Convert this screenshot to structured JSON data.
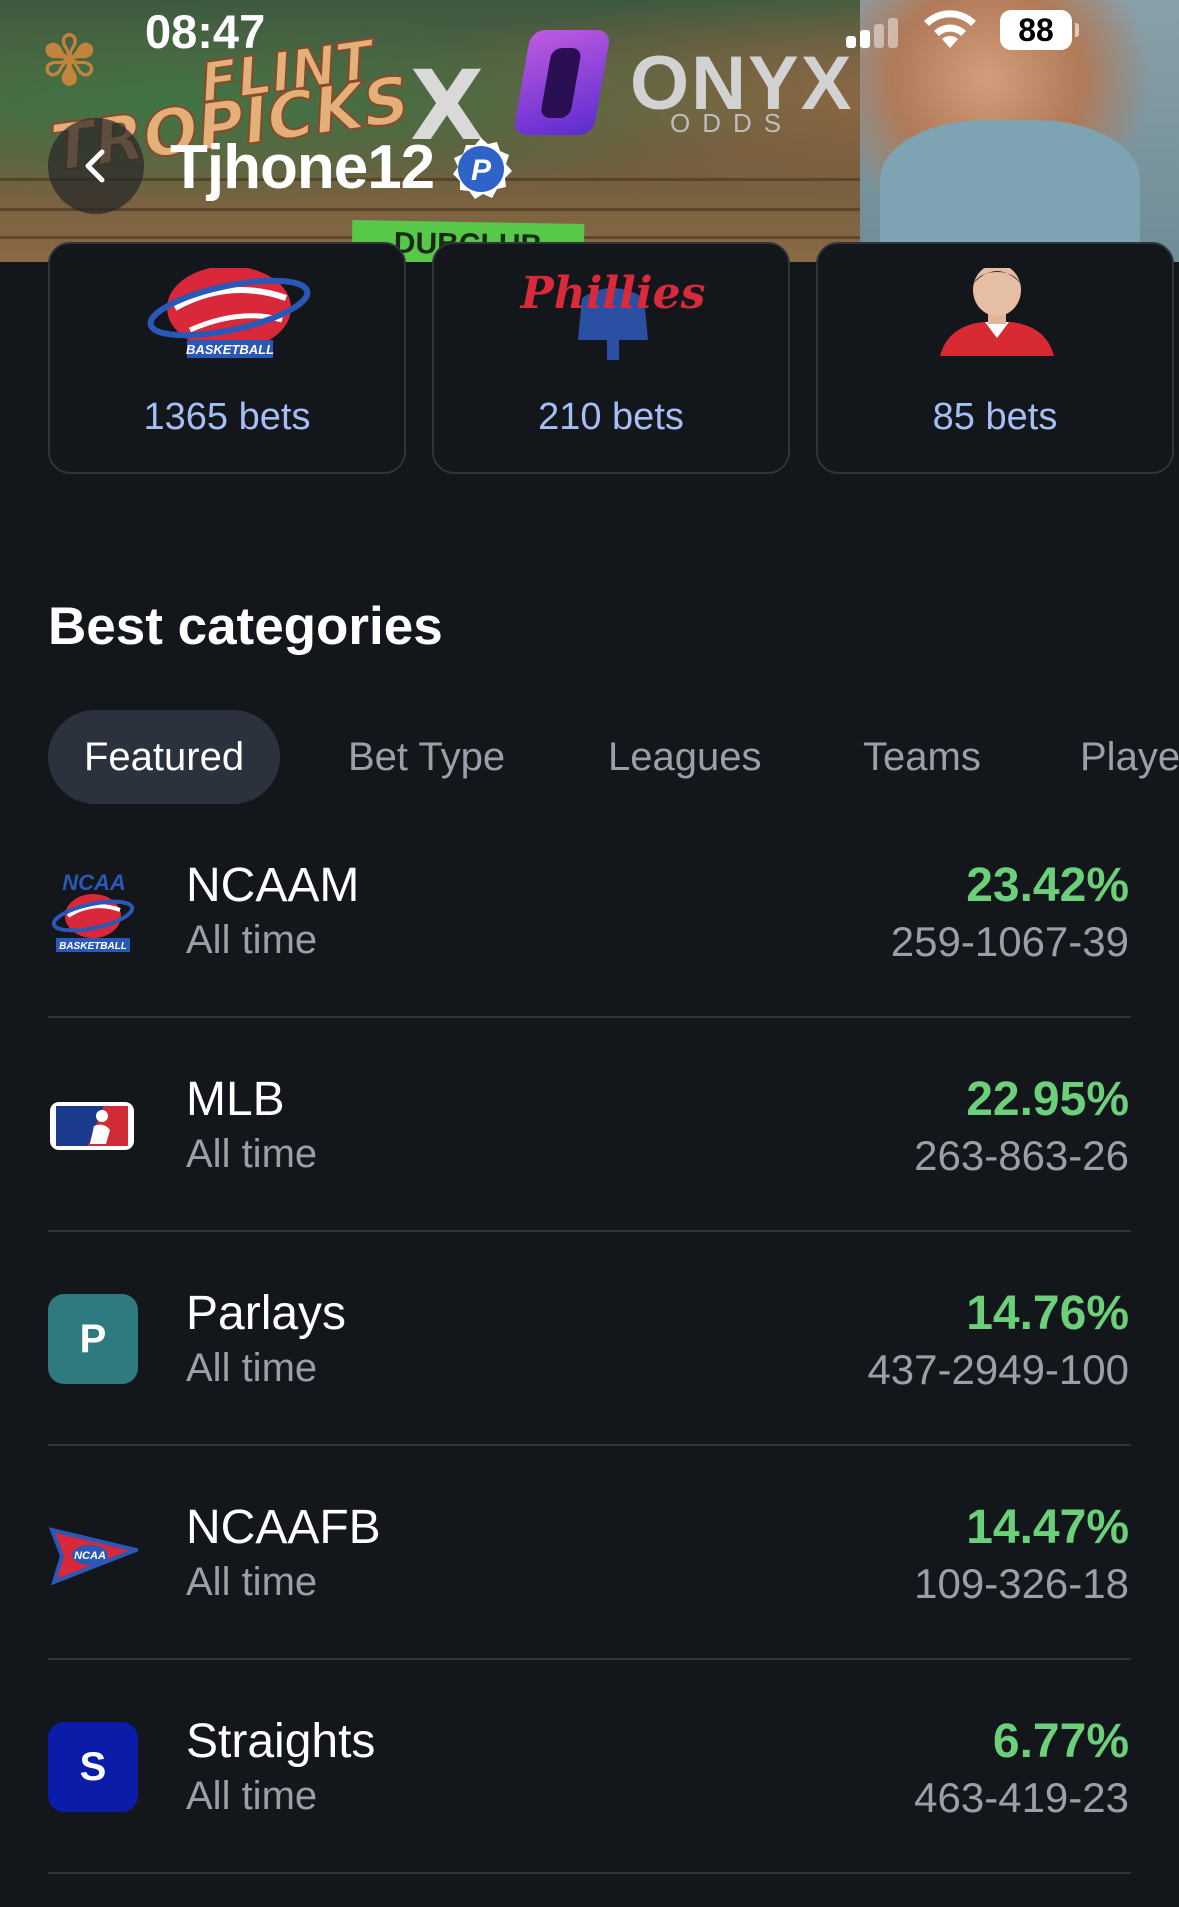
{
  "status_bar": {
    "time": "08:47",
    "battery": "88"
  },
  "banner": {
    "brand_left_line1": "FLINT",
    "brand_left_line2": "TROPICKS",
    "brand_x": "X",
    "brand_right": "ONYX",
    "brand_right_sub": "ODDS",
    "sponsor": "DUBCLUB"
  },
  "profile": {
    "name": "Tjhone12",
    "badge_letter": "P"
  },
  "top_cards": [
    {
      "icon": "ncaa-basketball-logo",
      "count": "1365 bets"
    },
    {
      "icon": "phillies-logo",
      "count": "210 bets"
    },
    {
      "icon": "player-headshot",
      "count": "85 bets"
    }
  ],
  "section": {
    "title": "Best categories"
  },
  "tabs": [
    {
      "label": "Featured",
      "active": true
    },
    {
      "label": "Bet Type",
      "active": false
    },
    {
      "label": "Leagues",
      "active": false
    },
    {
      "label": "Teams",
      "active": false
    },
    {
      "label": "Playe",
      "active": false
    }
  ],
  "categories": [
    {
      "name": "NCAAM",
      "period": "All time",
      "pct": "23.42%",
      "record": "259-1067-39",
      "icon": "ncaa-basketball-logo"
    },
    {
      "name": "MLB",
      "period": "All time",
      "pct": "22.95%",
      "record": "263-863-26",
      "icon": "mlb-logo"
    },
    {
      "name": "Parlays",
      "period": "All time",
      "pct": "14.76%",
      "record": "437-2949-100",
      "icon": "letter-badge",
      "letter": "P",
      "color": "#2e7a7e"
    },
    {
      "name": "NCAAFB",
      "period": "All time",
      "pct": "14.47%",
      "record": "109-326-18",
      "icon": "ncaa-football-logo"
    },
    {
      "name": "Straights",
      "period": "All time",
      "pct": "6.77%",
      "record": "463-419-23",
      "icon": "letter-badge",
      "letter": "S",
      "color": "#0b1ca8"
    }
  ],
  "colors": {
    "background": "#13161b",
    "positive": "#6ccf7a",
    "card_count": "#a5bff5",
    "muted": "#9aa0a8"
  }
}
